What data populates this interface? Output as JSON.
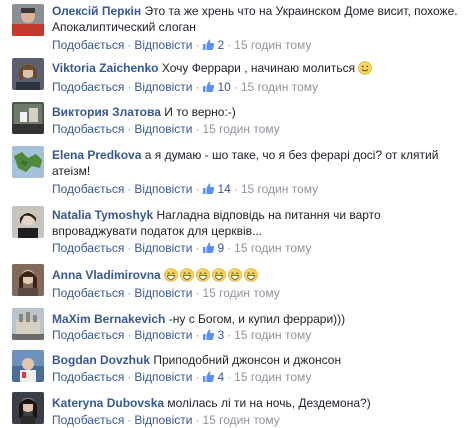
{
  "comments": [
    {
      "author": "Олексій Перкін",
      "text": "Это та же хрень что на Украинском Доме висит, похоже. Апокалиптический слоган",
      "like_label": "Подобається",
      "reply_label": "Відповісти",
      "likes": "2",
      "time": "15 годин тому"
    },
    {
      "author": "Viktoria Zaichenko",
      "text": "Хочу Феррари , начинаю молиться",
      "emoji": "smile-emoji",
      "like_label": "Подобається",
      "reply_label": "Відповісти",
      "likes": "10",
      "time": "15 годин тому"
    },
    {
      "author": "Виктория Златова",
      "text": "И то верно:-)",
      "like_label": "Подобається",
      "reply_label": "Відповісти",
      "time": "15 годин тому"
    },
    {
      "author": "Elena Predkova",
      "text": "а я думаю - шо таке, чо я без ферарі досі? от клятий атеізм!",
      "like_label": "Подобається",
      "reply_label": "Відповісти",
      "likes": "14",
      "time": "15 годин тому"
    },
    {
      "author": "Natalia Tymoshyk",
      "text": "Нагладна відповідь на питання чи варто впроваджувати податок для церквів...",
      "like_label": "Подобається",
      "reply_label": "Відповісти",
      "likes": "9",
      "time": "15 годин тому"
    },
    {
      "author": "Anna Vladimirovna",
      "emoji_count": 6,
      "emoji": "grin-emoji",
      "like_label": "Подобається",
      "reply_label": "Відповісти",
      "time": "15 годин тому"
    },
    {
      "author": "MaXim Bernakevich",
      "text": "-ну с Богом, и купил феррари)))",
      "like_label": "Подобається",
      "reply_label": "Відповісти",
      "likes": "3",
      "time": "15 годин тому"
    },
    {
      "author": "Bogdan Dovzhuk",
      "text": "Приподобний джонсон и джонсон",
      "like_label": "Подобається",
      "reply_label": "Відповісти",
      "likes": "4",
      "time": "15 годин тому"
    },
    {
      "author": "Kateryna Dubovska",
      "text": "молілась лі ти на ночь, Дездемона?)",
      "like_label": "Подобається",
      "reply_label": "Відповісти",
      "time": "15 годин тому"
    }
  ],
  "colors": {
    "author": "#365899",
    "text": "#1d2129",
    "meta": "#90949c",
    "like_icon": "#5890ff"
  }
}
